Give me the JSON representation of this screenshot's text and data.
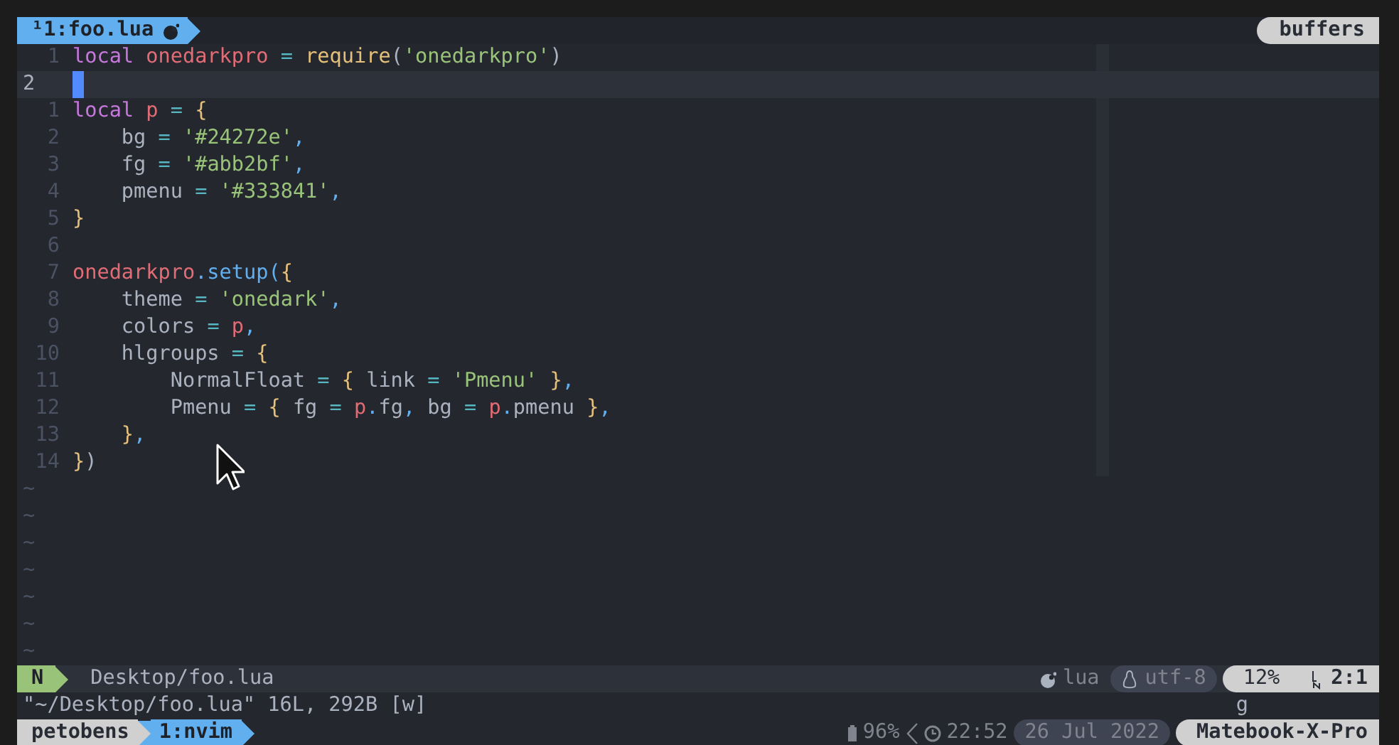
{
  "tabline": {
    "tab": {
      "label": "¹1:foo.lua",
      "selected": true
    },
    "buffers_label": "buffers"
  },
  "lines": [
    {
      "number": "1",
      "current": false,
      "segments": [
        {
          "text": "local ",
          "color": "#c678dd"
        },
        {
          "text": "onedarkpro ",
          "color": "#e06c75"
        },
        {
          "text": "= ",
          "color": "#56b6c2"
        },
        {
          "text": "require",
          "color": "#e5c07b"
        },
        {
          "text": "(",
          "color": "#abb2bf"
        },
        {
          "text": "'onedarkpro'",
          "color": "#98c379"
        },
        {
          "text": ")",
          "color": "#abb2bf"
        }
      ]
    },
    {
      "number": "2",
      "current": true
    },
    {
      "number": "1",
      "current": false,
      "segments": [
        {
          "text": "local ",
          "color": "#c678dd"
        },
        {
          "text": "p ",
          "color": "#e06c75"
        },
        {
          "text": "= ",
          "color": "#56b6c2"
        },
        {
          "text": "{",
          "color": "#e5c07b"
        }
      ]
    },
    {
      "number": "2",
      "current": false,
      "segments": [
        {
          "text": "    bg ",
          "color": "#abb2bf"
        },
        {
          "text": "= ",
          "color": "#56b6c2"
        },
        {
          "text": "'#24272e'",
          "color": "#98c379"
        },
        {
          "text": ",",
          "color": "#61afef"
        }
      ]
    },
    {
      "number": "3",
      "current": false,
      "segments": [
        {
          "text": "    fg ",
          "color": "#abb2bf"
        },
        {
          "text": "= ",
          "color": "#56b6c2"
        },
        {
          "text": "'#abb2bf'",
          "color": "#98c379"
        },
        {
          "text": ",",
          "color": "#61afef"
        }
      ]
    },
    {
      "number": "4",
      "current": false,
      "segments": [
        {
          "text": "    pmenu ",
          "color": "#abb2bf"
        },
        {
          "text": "= ",
          "color": "#56b6c2"
        },
        {
          "text": "'#333841'",
          "color": "#98c379"
        },
        {
          "text": ",",
          "color": "#61afef"
        }
      ]
    },
    {
      "number": "5",
      "current": false,
      "segments": [
        {
          "text": "}",
          "color": "#e5c07b"
        }
      ]
    },
    {
      "number": "6",
      "current": false
    },
    {
      "number": "7",
      "current": false,
      "segments": [
        {
          "text": "onedarkpro",
          "color": "#e06c75"
        },
        {
          "text": ".setup(",
          "color": "#61afef"
        },
        {
          "text": "{",
          "color": "#e5c07b"
        }
      ]
    },
    {
      "number": "8",
      "current": false,
      "segments": [
        {
          "text": "    theme ",
          "color": "#abb2bf"
        },
        {
          "text": "= ",
          "color": "#56b6c2"
        },
        {
          "text": "'onedark'",
          "color": "#98c379"
        },
        {
          "text": ",",
          "color": "#61afef"
        }
      ]
    },
    {
      "number": "9",
      "current": false,
      "segments": [
        {
          "text": "    colors ",
          "color": "#abb2bf"
        },
        {
          "text": "= ",
          "color": "#56b6c2"
        },
        {
          "text": "p",
          "color": "#e06c75"
        },
        {
          "text": ",",
          "color": "#61afef"
        }
      ]
    },
    {
      "number": "10",
      "current": false,
      "segments": [
        {
          "text": "    hlgroups ",
          "color": "#abb2bf"
        },
        {
          "text": "= ",
          "color": "#56b6c2"
        },
        {
          "text": "{",
          "color": "#e5c07b"
        }
      ]
    },
    {
      "number": "11",
      "current": false,
      "segments": [
        {
          "text": "        NormalFloat ",
          "color": "#abb2bf"
        },
        {
          "text": "= ",
          "color": "#56b6c2"
        },
        {
          "text": "{",
          "color": "#e5c07b"
        },
        {
          "text": " link ",
          "color": "#abb2bf"
        },
        {
          "text": "= ",
          "color": "#56b6c2"
        },
        {
          "text": "'Pmenu' ",
          "color": "#98c379"
        },
        {
          "text": "}",
          "color": "#e5c07b"
        },
        {
          "text": ",",
          "color": "#61afef"
        }
      ]
    },
    {
      "number": "12",
      "current": false,
      "segments": [
        {
          "text": "        Pmenu ",
          "color": "#abb2bf"
        },
        {
          "text": "= ",
          "color": "#56b6c2"
        },
        {
          "text": "{",
          "color": "#e5c07b"
        },
        {
          "text": " fg ",
          "color": "#abb2bf"
        },
        {
          "text": "= ",
          "color": "#56b6c2"
        },
        {
          "text": "p",
          "color": "#e06c75"
        },
        {
          "text": ".",
          "color": "#61afef"
        },
        {
          "text": "fg",
          "color": "#abb2bf"
        },
        {
          "text": ",",
          "color": "#61afef"
        },
        {
          "text": " bg ",
          "color": "#abb2bf"
        },
        {
          "text": "= ",
          "color": "#56b6c2"
        },
        {
          "text": "p",
          "color": "#e06c75"
        },
        {
          "text": ".",
          "color": "#61afef"
        },
        {
          "text": "pmenu ",
          "color": "#abb2bf"
        },
        {
          "text": "}",
          "color": "#e5c07b"
        },
        {
          "text": ",",
          "color": "#61afef"
        }
      ]
    },
    {
      "number": "13",
      "current": false,
      "segments": [
        {
          "text": "    }",
          "color": "#e5c07b"
        },
        {
          "text": ",",
          "color": "#61afef"
        }
      ]
    },
    {
      "number": "14",
      "current": false,
      "segments": [
        {
          "text": "}",
          "color": "#e5c07b"
        },
        {
          "text": ")",
          "color": "#abb2bf"
        }
      ]
    }
  ],
  "tildes": [
    "~",
    "~",
    "~",
    "~",
    "~",
    "~",
    "~"
  ],
  "statusline": {
    "mode": "N",
    "path": "Desktop/foo.lua",
    "filetype": "lua",
    "encoding": "utf-8",
    "percent": "12%",
    "position": "2:1"
  },
  "cmdline": {
    "message": "\"~/Desktop/foo.lua\" 16L, 292B [w]",
    "showcmd": "g"
  },
  "tmux": {
    "session": "petobens",
    "windows": [
      {
        "label": "1:nvim",
        "selected": true
      }
    ],
    "battery": "96%",
    "time": "22:52",
    "date": "26 Jul 2022",
    "host": "Matebook-X-Pro"
  }
}
